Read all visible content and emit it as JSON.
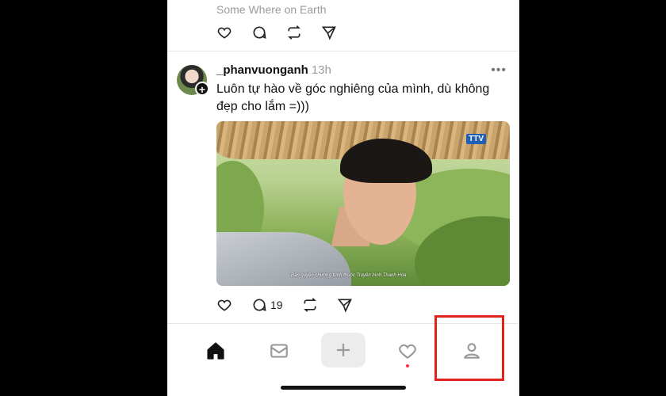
{
  "previous_post": {
    "location": "Some Where on Earth"
  },
  "post": {
    "username": "_phanvuonganh",
    "time": "13h",
    "more": "•••",
    "text": "Luôn tự hào về góc nghiêng của mình, dù không đẹp cho lắm =)))",
    "image": {
      "logo_text": "TTV",
      "caption": "Bản quyền chương trình thuộc Truyền hình Thanh Hóa"
    },
    "reply_count": "19"
  },
  "icons": {
    "like": "heart-icon",
    "reply": "comment-icon",
    "repost": "repost-icon",
    "share": "send-icon",
    "follow": "plus-icon"
  },
  "tabbar": {
    "create_symbol": "+",
    "items": [
      "home-icon",
      "inbox-icon",
      "create-icon",
      "activity-icon",
      "profile-icon"
    ]
  },
  "colors": {
    "highlight": "#e2231a",
    "notification_dot": "#ff3040",
    "text": "#111111",
    "muted": "#9a9a9a"
  }
}
